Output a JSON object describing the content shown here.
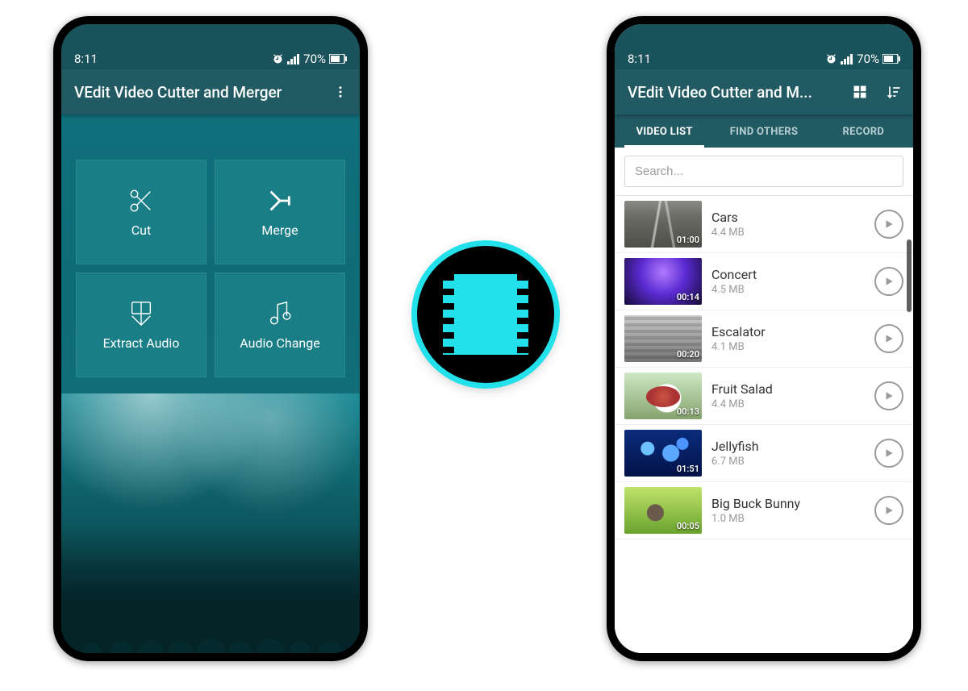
{
  "status": {
    "time": "8:11",
    "battery_text": "70%"
  },
  "screen1": {
    "app_title": "VEdit Video Cutter and Merger",
    "tiles": {
      "cut": "Cut",
      "merge": "Merge",
      "extract_audio": "Extract Audio",
      "audio_change": "Audio Change"
    }
  },
  "screen2": {
    "app_title": "VEdit Video Cutter and M...",
    "tabs": {
      "video_list": "VIDEO LIST",
      "find_others": "FIND OTHERS",
      "record": "RECORD"
    },
    "search_placeholder": "Search...",
    "items": [
      {
        "name": "Cars",
        "size": "4.4 MB",
        "duration": "01:00"
      },
      {
        "name": "Concert",
        "size": "4.5 MB",
        "duration": "00:14"
      },
      {
        "name": "Escalator",
        "size": "4.1 MB",
        "duration": "00:20"
      },
      {
        "name": "Fruit Salad",
        "size": "4.4 MB",
        "duration": "00:13"
      },
      {
        "name": "Jellyfish",
        "size": "6.7 MB",
        "duration": "01:51"
      },
      {
        "name": "Big Buck Bunny",
        "size": "1.0 MB",
        "duration": "00:05"
      }
    ]
  }
}
